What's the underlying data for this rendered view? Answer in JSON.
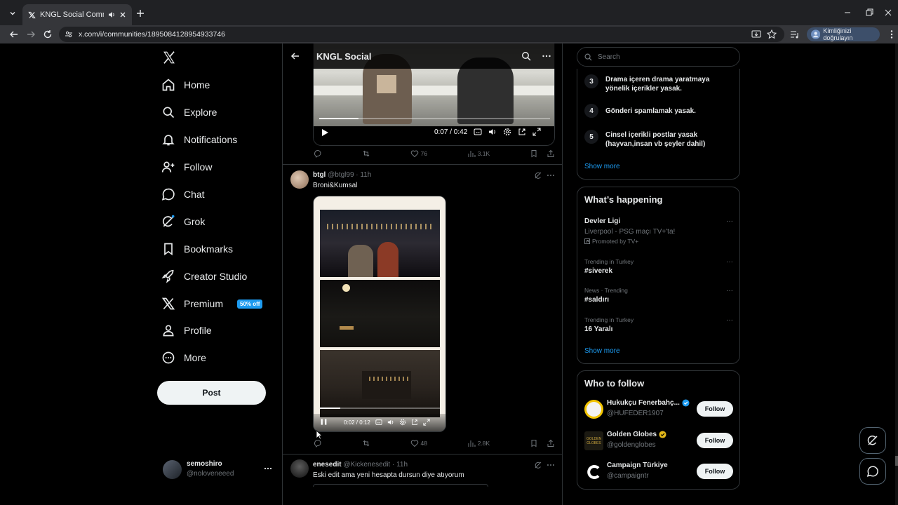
{
  "browser": {
    "tab_title": "KNGL Social Community / X",
    "url": "x.com/i/communities/1895084128954933746",
    "profile_label": "Kimliğinizi doğrulayın"
  },
  "nav": {
    "items": [
      {
        "label": "Home",
        "icon": "home-icon"
      },
      {
        "label": "Explore",
        "icon": "search-icon"
      },
      {
        "label": "Notifications",
        "icon": "bell-icon"
      },
      {
        "label": "Follow",
        "icon": "person-add-icon"
      },
      {
        "label": "Chat",
        "icon": "chat-bubble-icon"
      },
      {
        "label": "Grok",
        "icon": "grok-icon"
      },
      {
        "label": "Bookmarks",
        "icon": "bookmark-icon"
      },
      {
        "label": "Creator Studio",
        "icon": "rocket-icon"
      },
      {
        "label": "Premium",
        "icon": "x-logo-icon"
      },
      {
        "label": "Profile",
        "icon": "person-icon"
      },
      {
        "label": "More",
        "icon": "more-circle-icon"
      }
    ],
    "premium_badge": "50% off",
    "post_label": "Post"
  },
  "account": {
    "name": "semoshiro",
    "handle": "@noloveneeed"
  },
  "community": {
    "title": "KNGL Social"
  },
  "video1": {
    "time": "0:07 / 0:42",
    "progress": 0.17
  },
  "tweet1_actions": {
    "likes": "76",
    "views": "3.1K"
  },
  "tweet2": {
    "name": "btgl",
    "handle": "@btgl99",
    "time": "· 11h",
    "text": "Broni&Kumsal",
    "video_time": "0:02 / 0:12",
    "progress": 0.17,
    "likes": "48",
    "views": "2.8K"
  },
  "tweet3": {
    "name": "enesedit",
    "handle": "@Kickenesedit",
    "time": "· 11h",
    "text": "Eski edit ama yeni hesapta dursun diye atıyorum"
  },
  "search": {
    "placeholder": "Search"
  },
  "rules": [
    {
      "num": "3",
      "text": "Drama içeren drama yaratmaya yönelik içerikler yasak."
    },
    {
      "num": "4",
      "text": "Gönderi spamlamak yasak."
    },
    {
      "num": "5",
      "text": "Cinsel içerikli postlar yasak (hayvan,insan vb şeyler dahil)"
    }
  ],
  "show_more": "Show more",
  "happening": {
    "title": "What’s happening",
    "promo": {
      "name": "Devler Ligi",
      "desc": "Liverpool - PSG maçı TV+'ta!",
      "sponsor": "Promoted by TV+"
    },
    "trends": [
      {
        "meta": "Trending in Turkey",
        "name": "#siverek"
      },
      {
        "meta": "News · Trending",
        "name": "#saldırı"
      },
      {
        "meta": "Trending in Turkey",
        "name": "16 Yaralı"
      }
    ]
  },
  "who_to_follow": {
    "title": "Who to follow",
    "follow_label": "Follow",
    "accounts": [
      {
        "name": "Hukukçu Fenerbahç...",
        "handle": "@HUFEDER1907",
        "verified": "blue"
      },
      {
        "name": "Golden Globes",
        "handle": "@goldenglobes",
        "verified": "gold"
      },
      {
        "name": "Campaign Türkiye",
        "handle": "@campaigntr",
        "verified": "none"
      }
    ]
  },
  "colors": {
    "accent": "#1d9bf0",
    "background": "#000000",
    "gold": "#e2b719"
  }
}
